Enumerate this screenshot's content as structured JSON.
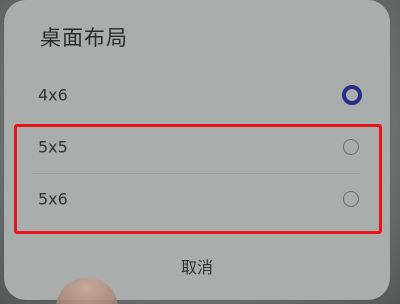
{
  "dialog": {
    "title": "桌面布局",
    "options": [
      {
        "label": "4x6",
        "selected": true
      },
      {
        "label": "5x5",
        "selected": false
      },
      {
        "label": "5x6",
        "selected": false
      }
    ],
    "cancel_label": "取消"
  },
  "colors": {
    "highlight": "#e8141a",
    "radio_selected": "#2b2d8a"
  }
}
